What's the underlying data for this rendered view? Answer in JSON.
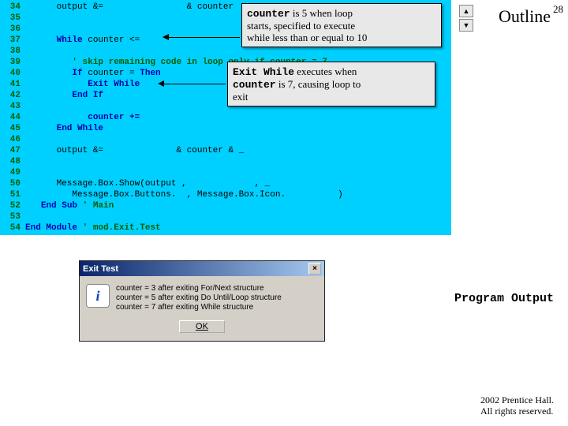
{
  "page_number": "28",
  "outline_label": "Outline",
  "nav": {
    "up": "▲",
    "down": "▼"
  },
  "code": {
    "lines": [
      {
        "n": "34",
        "kw1": "output &=",
        "rest": "                ",
        "kw2": "& counter"
      },
      {
        "n": "35",
        "kw1": "",
        "rest": ""
      },
      {
        "n": "36",
        "kw1": "",
        "rest": ""
      },
      {
        "n": "37",
        "kw1": "While",
        "rest": " counter <="
      },
      {
        "n": "38",
        "kw1": "",
        "rest": ""
      },
      {
        "n": "39",
        "comment": "' skip remaining code in loop only if counter = 7"
      },
      {
        "n": "40",
        "kw1": "If",
        "mid": " counter = ",
        "kw2": "Then"
      },
      {
        "n": "41",
        "kw1": "Exit While",
        "rest": ""
      },
      {
        "n": "42",
        "kw1": "End If",
        "rest": ""
      },
      {
        "n": "43",
        "kw1": "",
        "rest": ""
      },
      {
        "n": "44",
        "kw1": "counter +=",
        "rest": ""
      },
      {
        "n": "45",
        "kw1": "End While",
        "rest": ""
      },
      {
        "n": "46",
        "kw1": "",
        "rest": ""
      },
      {
        "n": "47",
        "kw1": "output &=",
        "rest": "              ",
        "kw2": "& counter & _"
      },
      {
        "n": "48",
        "kw1": "",
        "rest": ""
      },
      {
        "n": "49",
        "kw1": "",
        "rest": ""
      },
      {
        "n": "50",
        "kw1": "Message.Box.Show(output ,",
        "rest": "             ",
        "kw2": ", _"
      },
      {
        "n": "51",
        "kw1": "Message.Box.Buttons.",
        "mid": "  , ",
        "kw2": "Message.Box.Icon.",
        "tail": "          )"
      },
      {
        "n": "52",
        "kw1": "End Sub",
        "comment": " ' Main"
      },
      {
        "n": "53",
        "kw1": "",
        "rest": ""
      },
      {
        "n": "54",
        "kw1": "End Module",
        "comment": " ' mod.Exit.Test"
      }
    ]
  },
  "callouts": {
    "c1": {
      "kw1": "counter",
      "line1": " is 5 when loop",
      "line2": "starts, specified to execute",
      "line3": "while less than or equal to 10"
    },
    "c2": {
      "kw1": "Exit While",
      "line1": " executes when",
      "kw2": "counter",
      "line2": " is 7, causing loop to",
      "line3": "exit"
    }
  },
  "dialog": {
    "title": "Exit Test",
    "icon_letter": "i",
    "body": "counter = 3 after exiting For/Next structure\ncounter = 5 after exiting Do Until/Loop structure\ncounter = 7 after exiting While structure",
    "ok": "OK"
  },
  "program_output_label": "Program Output",
  "copyright": {
    "l1": "  2002 Prentice Hall.",
    "l2": "All rights reserved."
  }
}
